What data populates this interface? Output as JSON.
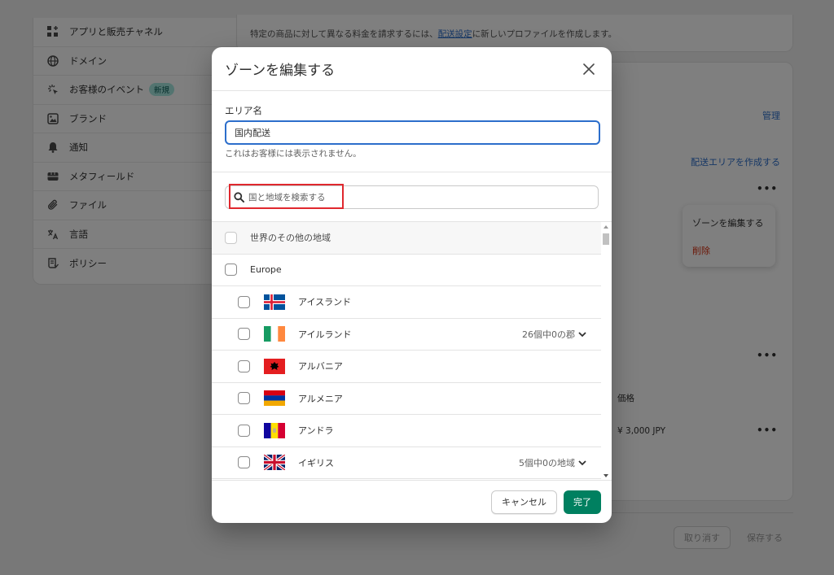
{
  "sidebar": {
    "items": [
      {
        "label": "アプリと販売チャネル",
        "icon": "apps-icon"
      },
      {
        "label": "ドメイン",
        "icon": "globe-icon"
      },
      {
        "label": "お客様のイベント",
        "icon": "sparkle-icon",
        "badge": "新規"
      },
      {
        "label": "ブランド",
        "icon": "brand-icon"
      },
      {
        "label": "通知",
        "icon": "bell-icon"
      },
      {
        "label": "メタフィールド",
        "icon": "metafield-icon"
      },
      {
        "label": "ファイル",
        "icon": "paperclip-icon"
      },
      {
        "label": "言語",
        "icon": "language-icon"
      },
      {
        "label": "ポリシー",
        "icon": "policy-icon"
      }
    ]
  },
  "background": {
    "notice_before": "特定の商品に対して異なる料金を請求するには、",
    "notice_link": "配送設定",
    "notice_after": "に新しいプロファイルを作成します。",
    "manage_link": "管理",
    "create_zone_link": "配送エリアを作成する",
    "menu_dots": "•••",
    "popover": {
      "edit": "ゾーンを編集する",
      "delete": "削除"
    },
    "price_header": "価格",
    "price_value": "¥ 3,000 JPY",
    "discard_button": "取り消す",
    "save_button": "保存する"
  },
  "modal": {
    "title": "ゾーンを編集する",
    "area_label": "エリア名",
    "area_value": "国内配送",
    "area_help": "これはお客様には表示されません。",
    "search_placeholder": "国と地域を検索する",
    "rest_of_world": "世界のその他の地域",
    "group_europe": "Europe",
    "countries": [
      {
        "name": "アイスランド",
        "flag": "iceland",
        "regions": ""
      },
      {
        "name": "アイルランド",
        "flag": "ireland",
        "regions": "26個中0の郡"
      },
      {
        "name": "アルバニア",
        "flag": "albania",
        "regions": ""
      },
      {
        "name": "アルメニア",
        "flag": "armenia",
        "regions": ""
      },
      {
        "name": "アンドラ",
        "flag": "andorra",
        "regions": ""
      },
      {
        "name": "イギリス",
        "flag": "uk",
        "regions": "5個中0の地域"
      }
    ],
    "cancel_button": "キャンセル",
    "done_button": "完了"
  },
  "colors": {
    "primary_button": "#008060",
    "focus_border": "#2c6ecb",
    "link": "#2c6ecb",
    "danger": "#d72c0d",
    "search_highlight": "#e0282e"
  }
}
